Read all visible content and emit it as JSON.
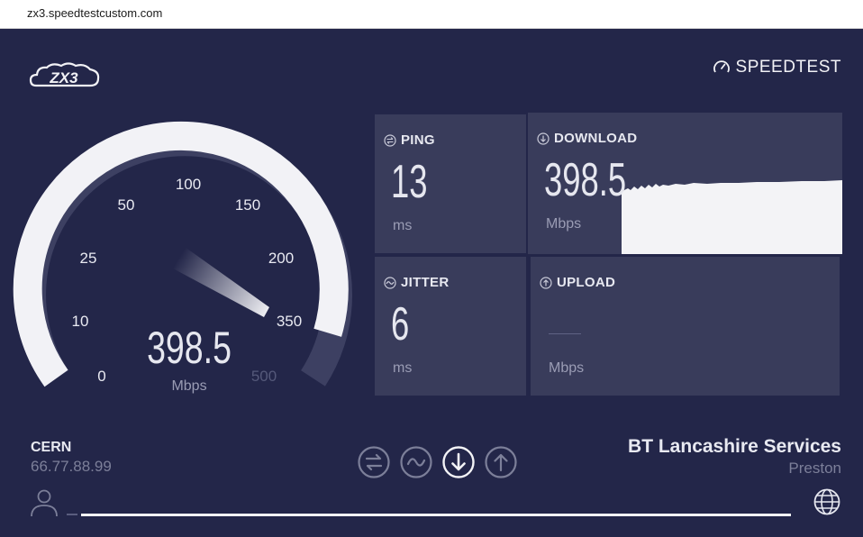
{
  "browser": {
    "url": "zx3.speedtestcustom.com"
  },
  "logo": {
    "text": "ZX3"
  },
  "brand": {
    "name": "SPEEDTEST"
  },
  "gauge": {
    "ticks": [
      "0",
      "10",
      "25",
      "50",
      "100",
      "150",
      "200",
      "350",
      "500"
    ],
    "value": "398.5",
    "unit": "Mbps"
  },
  "metrics": {
    "ping": {
      "label": "PING",
      "value": "13",
      "unit": "ms"
    },
    "download": {
      "label": "DOWNLOAD",
      "value": "398.5",
      "unit": "Mbps"
    },
    "jitter": {
      "label": "JITTER",
      "value": "6",
      "unit": "ms"
    },
    "upload": {
      "label": "UPLOAD",
      "value": "",
      "unit": "Mbps"
    }
  },
  "client": {
    "isp": "CERN",
    "ip": "66.77.88.99"
  },
  "server": {
    "sponsor": "BT Lancashire Services",
    "location": "Preston"
  },
  "modes": [
    {
      "icon": "ping-icon",
      "active": false
    },
    {
      "icon": "jitter-icon",
      "active": false
    },
    {
      "icon": "download-icon",
      "active": true
    },
    {
      "icon": "upload-icon",
      "active": false
    }
  ],
  "progress": {
    "fraction": 0.98
  },
  "colors": {
    "background": "#232649",
    "card": "#393c5b",
    "accent": "#f3f3f6",
    "muted": "#7c7f99",
    "gauge_track": "#3d4062"
  }
}
